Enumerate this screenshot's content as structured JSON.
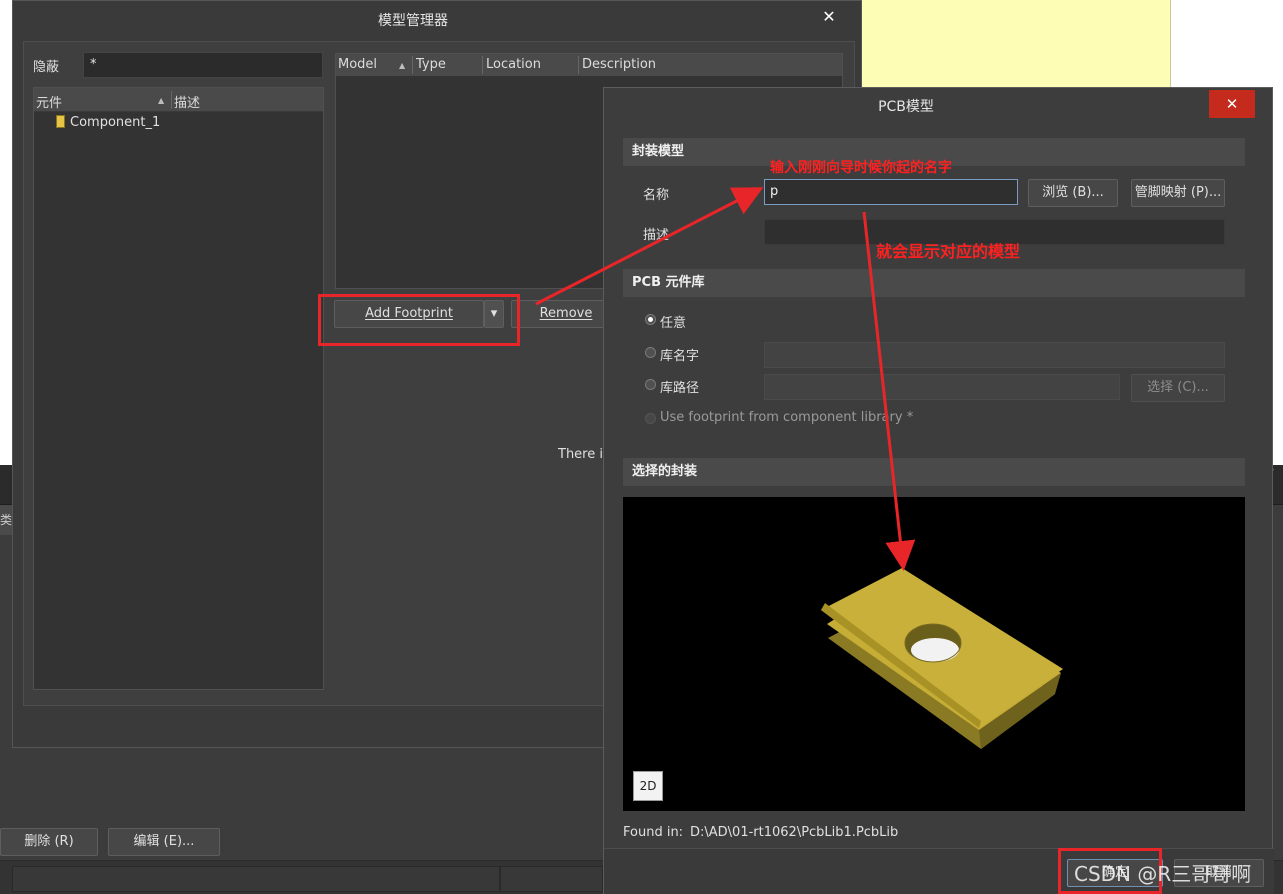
{
  "model_manager": {
    "title": "模型管理器",
    "hide_label": "隐蔽",
    "hide_value": "*",
    "component_col": "元件",
    "description_col": "描述",
    "components": [
      "Component_1"
    ],
    "model_columns": [
      "Model",
      "Type",
      "Location",
      "Description"
    ],
    "add_footprint": "Add Footprint",
    "remove": "Remove",
    "notice": "There is"
  },
  "background": {
    "delete_button": "删除 (R)",
    "edit_button": "编辑 (E)...",
    "left_tab": "类型"
  },
  "pcb_model": {
    "title": "PCB模型",
    "footprint_section": "封装模型",
    "name_label": "名称",
    "name_value": "p",
    "browse_button": "浏览 (B)...",
    "pin_map_button": "管脚映射 (P)...",
    "desc_label": "描述",
    "library_section": "PCB 元件库",
    "opt_any": "任意",
    "opt_lib_name": "库名字",
    "opt_lib_path": "库路径",
    "choose_button": "选择 (C)...",
    "use_footprint": "Use footprint from component library *",
    "selected_section": "选择的封装",
    "view_2d": "2D",
    "found_in_label": "Found in:",
    "found_in_path": "D:\\AD\\01-rt1062\\PcbLib1.PcbLib",
    "ok_button": "确定",
    "cancel_button": "取消"
  },
  "annotations": {
    "note_name": "输入刚刚向导时候你起的名字",
    "note_model": "就会显示对应的模型",
    "watermark": "CSDN @R三哥哥啊"
  },
  "colors": {
    "annotation_red": "#e8262a",
    "pad_gold": "#c8b03a",
    "close_red": "#c42b1c"
  }
}
